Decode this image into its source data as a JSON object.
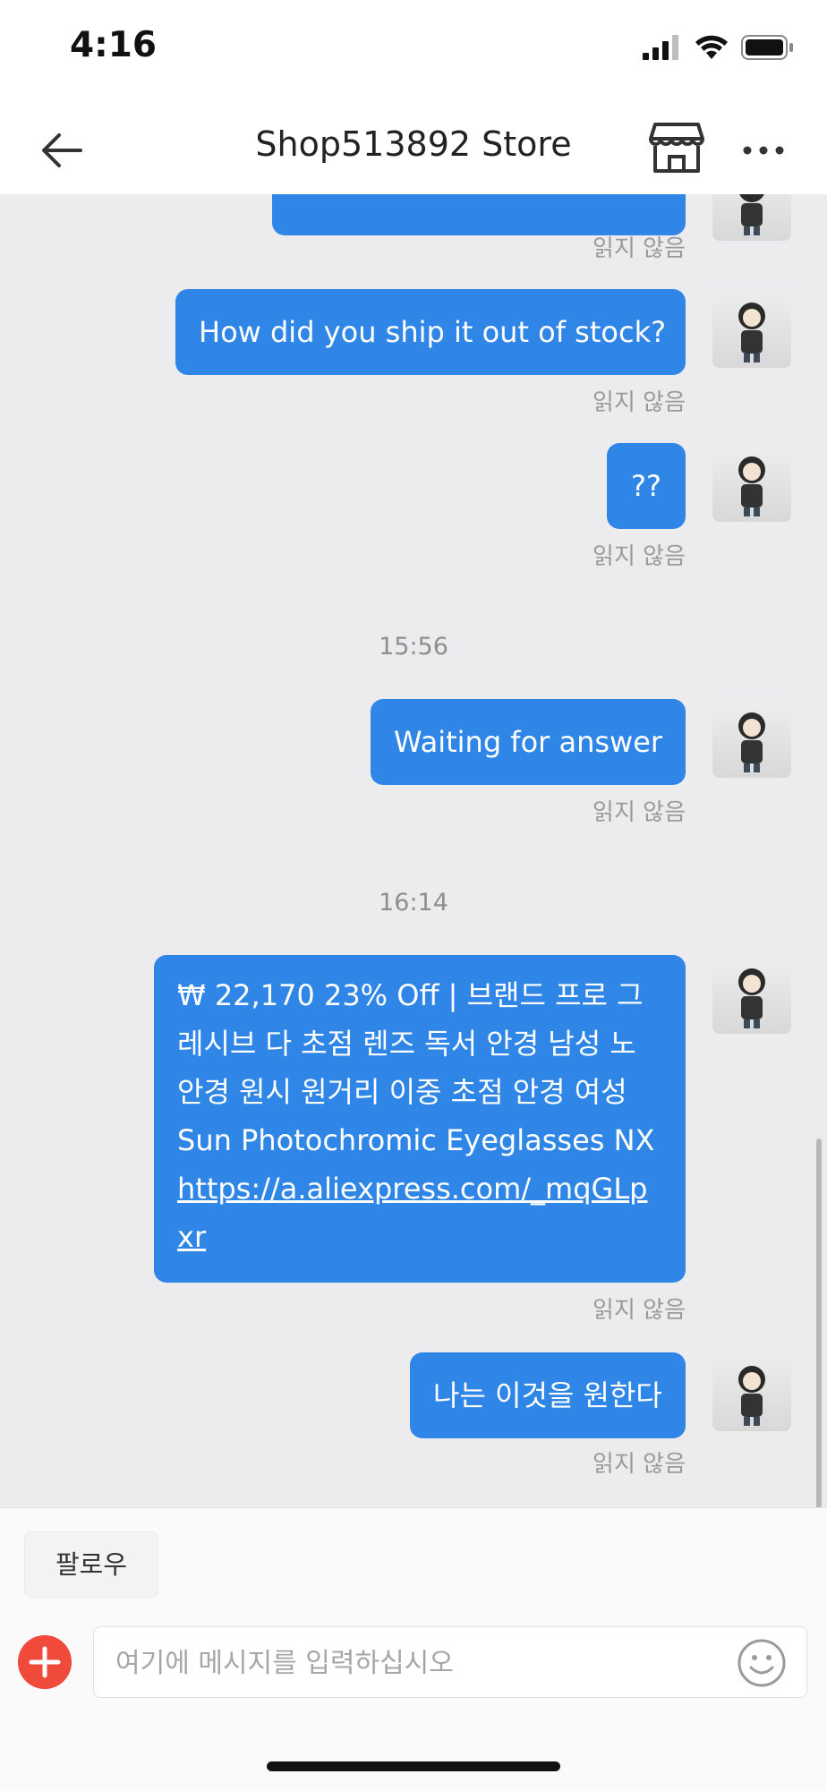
{
  "status_bar": {
    "time": "4:16"
  },
  "header": {
    "title": "Shop513892 Store"
  },
  "chat": {
    "messages": [
      {
        "text": "",
        "read_status": "읽지 않음"
      },
      {
        "text": "How did you ship it out of stock?",
        "read_status": "읽지 않음"
      },
      {
        "text": "??",
        "read_status": "읽지 않음"
      },
      {
        "text": "Waiting for answer",
        "read_status": "읽지 않음"
      },
      {
        "text": "₩ 22,170  23% Off | 브랜드 프로 그레시브 다 초점 렌즈 독서 안경 남성 노안경 원시 원거리 이중 초점 안경 여성 Sun Photochromic Eyeglasses NX",
        "link": "https://a.aliexpress.com/_mqGLpxr",
        "read_status": "읽지 않음"
      },
      {
        "text": "나는 이것을 원한다",
        "read_status": "읽지 않음"
      }
    ],
    "timestamps": [
      "15:56",
      "16:14"
    ]
  },
  "bottom_bar": {
    "follow_label": "팔로우",
    "input_placeholder": "여기에 메시지를 입력하십시오"
  },
  "colors": {
    "bubble": "#2f86e6",
    "accent_red": "#f04a3a",
    "chat_bg": "#ececee"
  }
}
